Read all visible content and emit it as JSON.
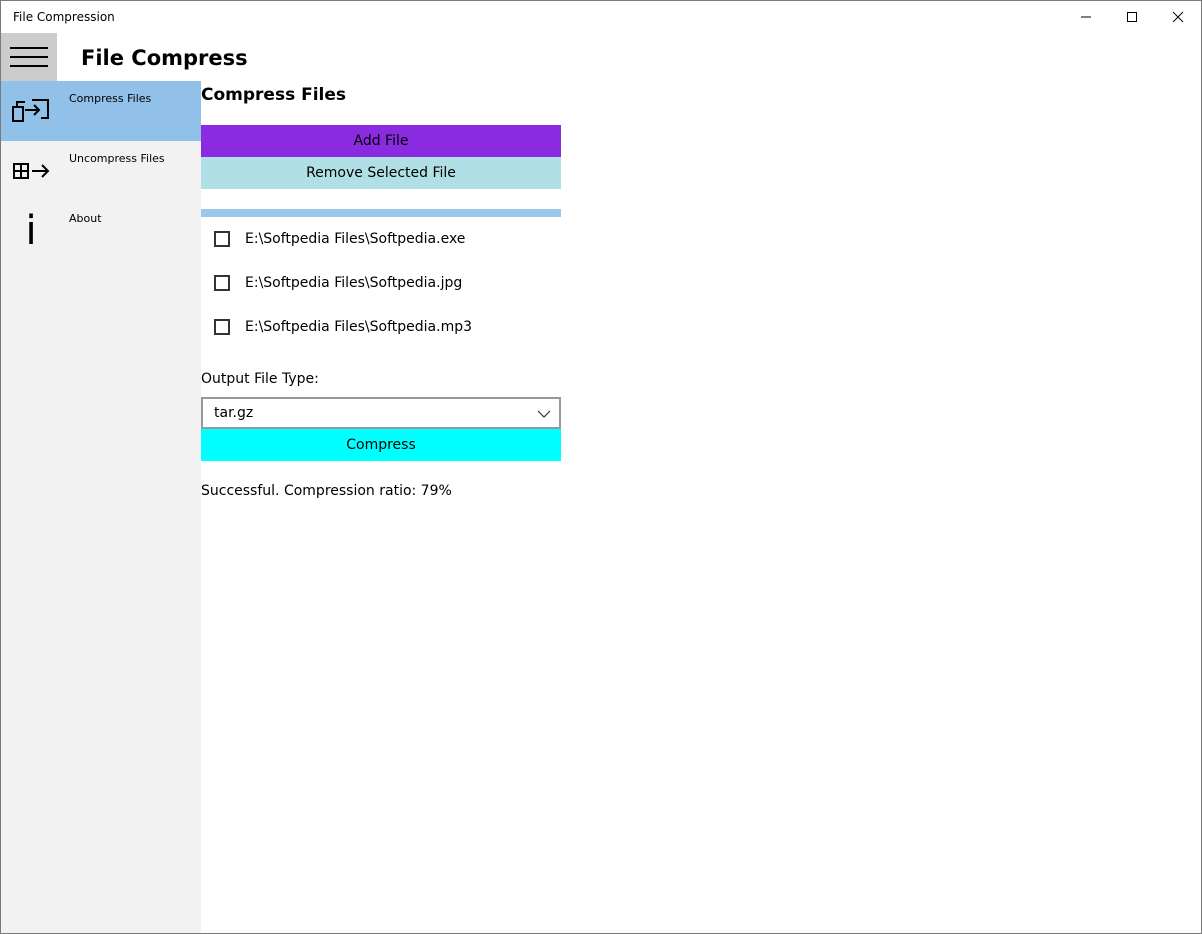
{
  "window": {
    "title": "File Compression"
  },
  "header": {
    "app_title": "File Compress"
  },
  "sidebar": {
    "items": [
      {
        "label": "Compress Files",
        "icon": "compress-icon",
        "active": true
      },
      {
        "label": "Uncompress Files",
        "icon": "uncompress-icon",
        "active": false
      },
      {
        "label": "About",
        "icon": "info-icon",
        "active": false
      }
    ]
  },
  "main": {
    "section_title": "Compress Files",
    "add_file_label": "Add File",
    "remove_file_label": "Remove Selected File",
    "files": [
      {
        "path": "E:\\Softpedia Files\\Softpedia.exe",
        "checked": false
      },
      {
        "path": "E:\\Softpedia Files\\Softpedia.jpg",
        "checked": false
      },
      {
        "path": "E:\\Softpedia Files\\Softpedia.mp3",
        "checked": false
      }
    ],
    "output_label": "Output File Type:",
    "output_type": "tar.gz",
    "compress_label": "Compress",
    "status": "Successful. Compression ratio: 79%",
    "progress_fraction": 1.0
  },
  "colors": {
    "add_button": "#8a2be2",
    "remove_button": "#b0e0e6",
    "compress_button": "#00ffff",
    "sidebar_active": "#91c0e8",
    "progress": "#9ac7ea"
  },
  "info_glyph": "i"
}
